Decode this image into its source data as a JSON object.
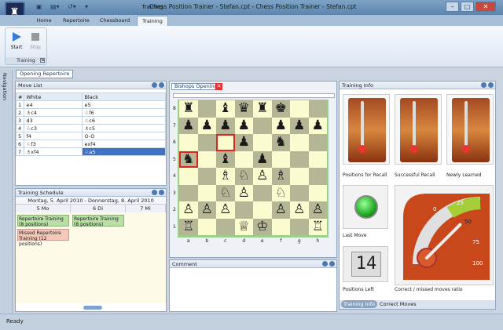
{
  "window": {
    "title": "Chess Position Trainer - Stefan.cpt - Chess Position Trainer - Stefan.cpt",
    "context_tab": "Training"
  },
  "ribbon": {
    "tabs": [
      "Home",
      "Repertoire",
      "Chessboard",
      "Training"
    ],
    "group_label": "Training",
    "start_label": "Start",
    "stop_label": "Stop"
  },
  "doc_tab": "Opening Repertoire",
  "nav_label": "Navigation",
  "move_list": {
    "title": "Move List",
    "headers": [
      "#",
      "White",
      "Black"
    ],
    "rows": [
      {
        "n": "1",
        "w": "e4",
        "b": "e5"
      },
      {
        "n": "2",
        "w": "♗c4",
        "b": "♘f6"
      },
      {
        "n": "3",
        "w": "d3",
        "b": "♘c6"
      },
      {
        "n": "4",
        "w": "♘c3",
        "b": "♗c5"
      },
      {
        "n": "5",
        "w": "f4",
        "b": "O-O"
      },
      {
        "n": "6",
        "w": "♘f3",
        "b": "exf4"
      },
      {
        "n": "7",
        "w": "♗xf4",
        "b": "♘a5"
      }
    ]
  },
  "schedule": {
    "title": "Training Schedule",
    "range": "Montag, 5. April 2010 - Donnerstag, 8. April 2010",
    "days": [
      "5 Mo",
      "6 Di",
      "7 Mi"
    ],
    "appt1": "Repertoire Training (8 positions)",
    "appt2": "Repertoire Training (8 positions)",
    "appt3": "Missed Repertoire Training (12 positions)"
  },
  "board": {
    "tab": "Bishops Opening",
    "ranks": [
      "8",
      "7",
      "6",
      "5",
      "4",
      "3",
      "2",
      "1"
    ],
    "files": [
      "a",
      "b",
      "c",
      "d",
      "e",
      "f",
      "g",
      "h"
    ],
    "position": [
      "♜ ♝♛♜♚ ",
      "♟♟♟♟ ♟♟♟",
      "   ♟ ♞  ",
      "♞ ♝ ♟   ",
      "  ♗♘♙♗  ",
      "  ♘♙ ♘  ",
      "♙♙♙  ♙♙♙",
      "♖  ♕♔  ♖"
    ],
    "comment_title": "Comment"
  },
  "training_info": {
    "title": "Training Info",
    "recall": "Positions for Recall",
    "success": "Successful Recall",
    "newly": "Newly Learned",
    "last_move": "Last Move",
    "positions_left": "Positions Left",
    "positions_left_value": "14",
    "gauge_label": "Correct / missed moves ratio",
    "gauge_ticks": [
      "0",
      "25",
      "50",
      "75",
      "100"
    ],
    "gauge_value": 50,
    "tab1": "Training Info",
    "tab2": "Correct Moves"
  },
  "status": "Ready",
  "colors": {
    "light_square": "#fbfbd0",
    "dark_square": "#b4b696",
    "selected_row": "#3f73c4"
  }
}
